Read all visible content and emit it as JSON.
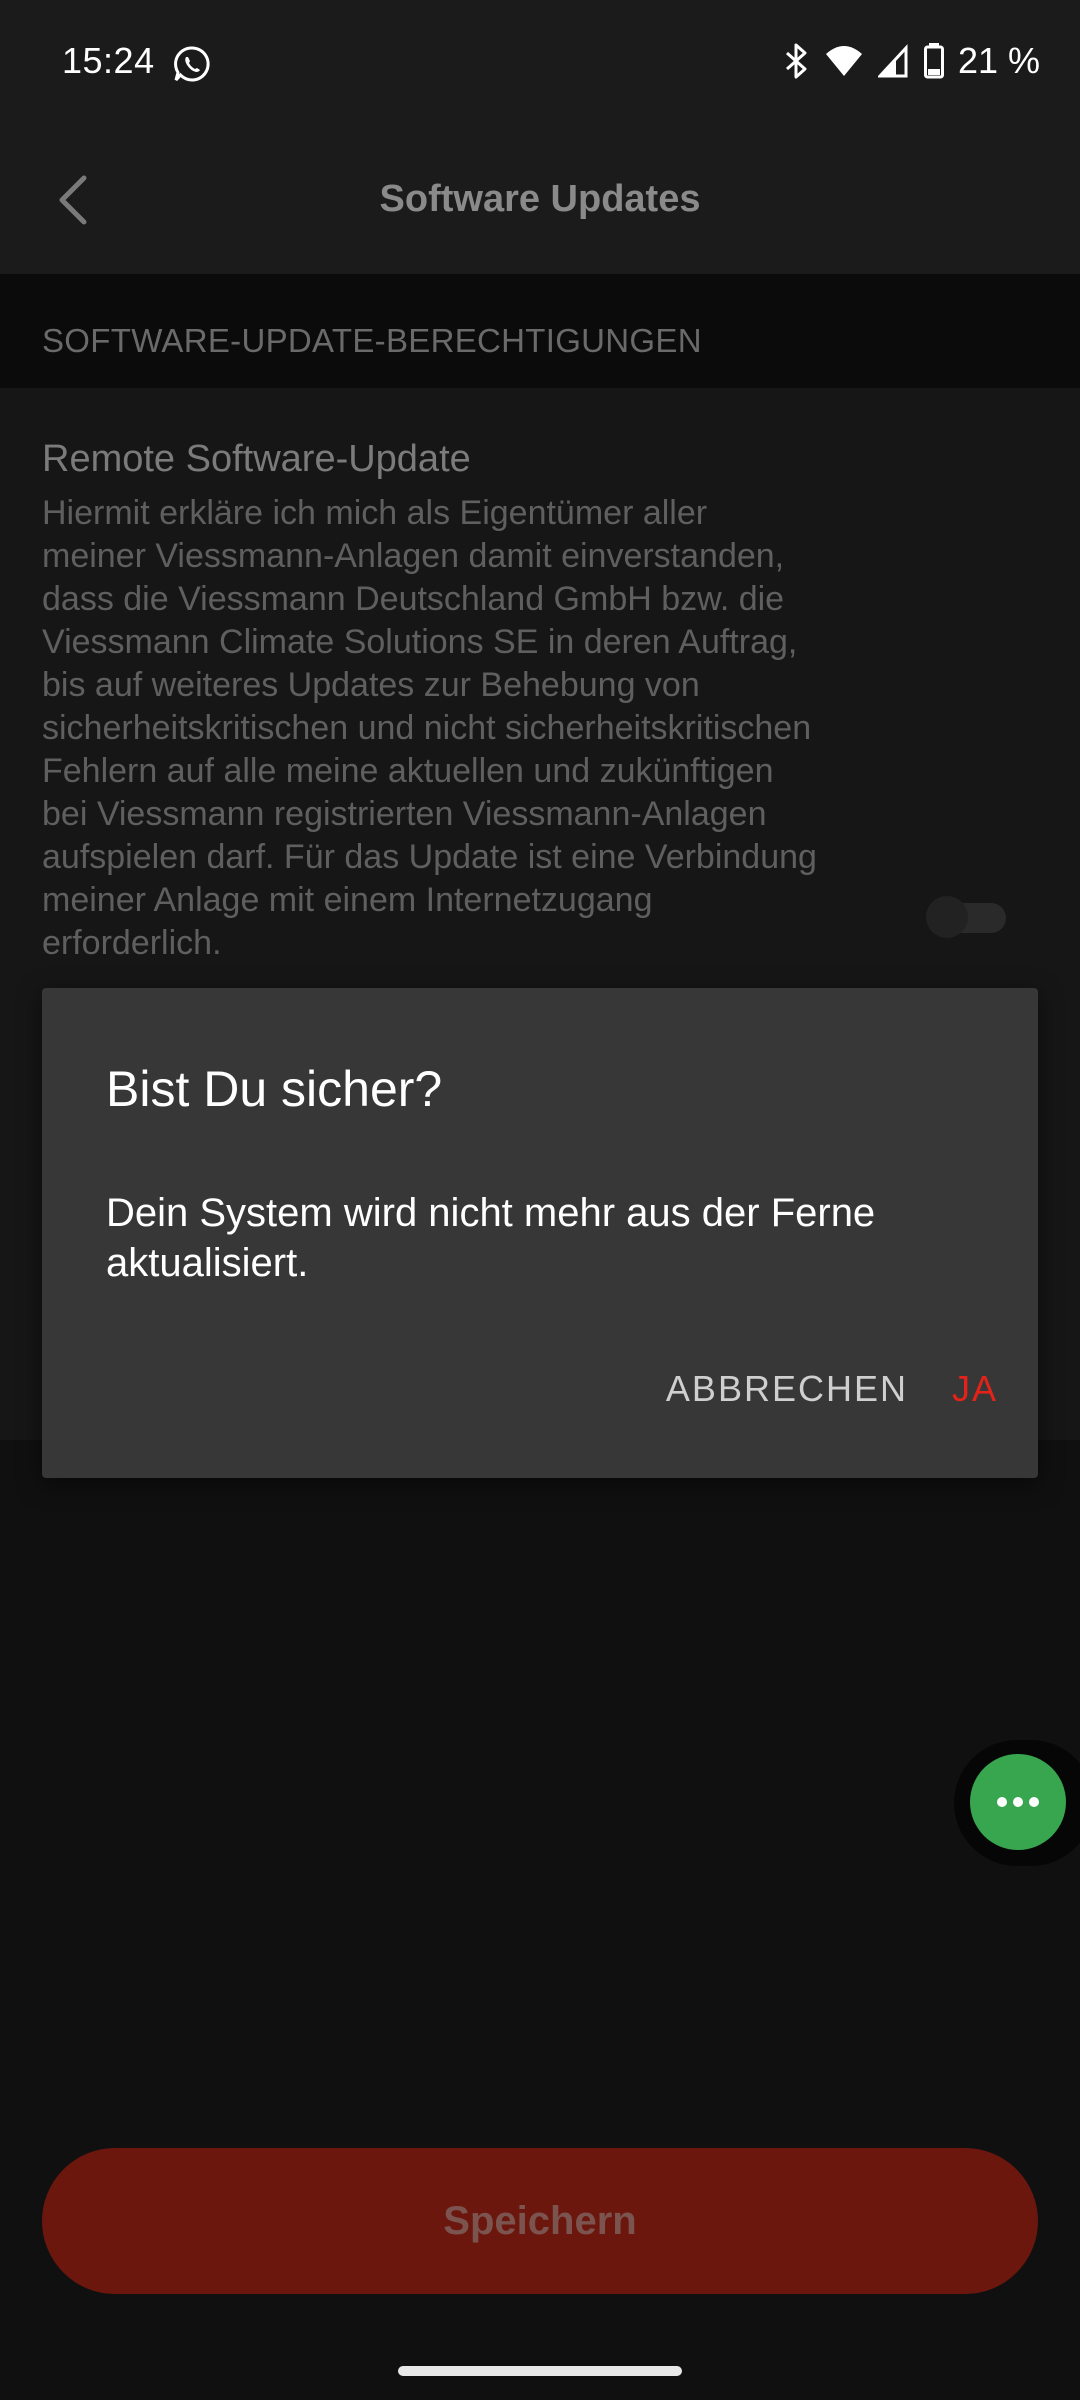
{
  "status_bar": {
    "time": "15:24",
    "battery_percent": "21 %"
  },
  "app_bar": {
    "title": "Software Updates"
  },
  "section": {
    "header": "SOFTWARE-UPDATE-BERECHTIGUNGEN"
  },
  "setting": {
    "title": "Remote Software-Update",
    "description_lines": [
      "Hiermit erkläre ich mich als Eigentümer aller",
      "meiner Viessmann-Anlagen damit einverstanden,",
      "dass die Viessmann Deutschland GmbH bzw. die",
      "Viessmann Climate Solutions SE in deren Auftrag,",
      "bis auf weiteres Updates zur Behebung von",
      "sicherheitskritischen und nicht sicherheitskritischen",
      "Fehlern auf alle meine aktuellen und zukünftigen",
      "bei Viessmann registrierten Viessmann-Anlagen",
      "aufspielen darf. Für das Update ist eine Verbindung",
      "meiner Anlage mit einem Internetzugang",
      "erforderlich."
    ],
    "toggle_on": false
  },
  "dialog": {
    "title": "Bist Du sicher?",
    "message": "Dein System wird nicht mehr aus der Ferne aktualisiert.",
    "cancel_label": "ABBRECHEN",
    "confirm_label": "JA"
  },
  "footer": {
    "save_label": "Speichern"
  },
  "colors": {
    "accent": "#e2231a",
    "save_button_dimmed": "#6b170d",
    "chat_fab": "#37a64f"
  },
  "icons": {
    "back": "chevron-left-icon",
    "chat": "more-horizontal-icon",
    "whatsapp": "whatsapp-icon",
    "bluetooth": "bluetooth-icon",
    "wifi": "wifi-icon",
    "cell": "cell-signal-icon",
    "battery": "battery-icon"
  }
}
